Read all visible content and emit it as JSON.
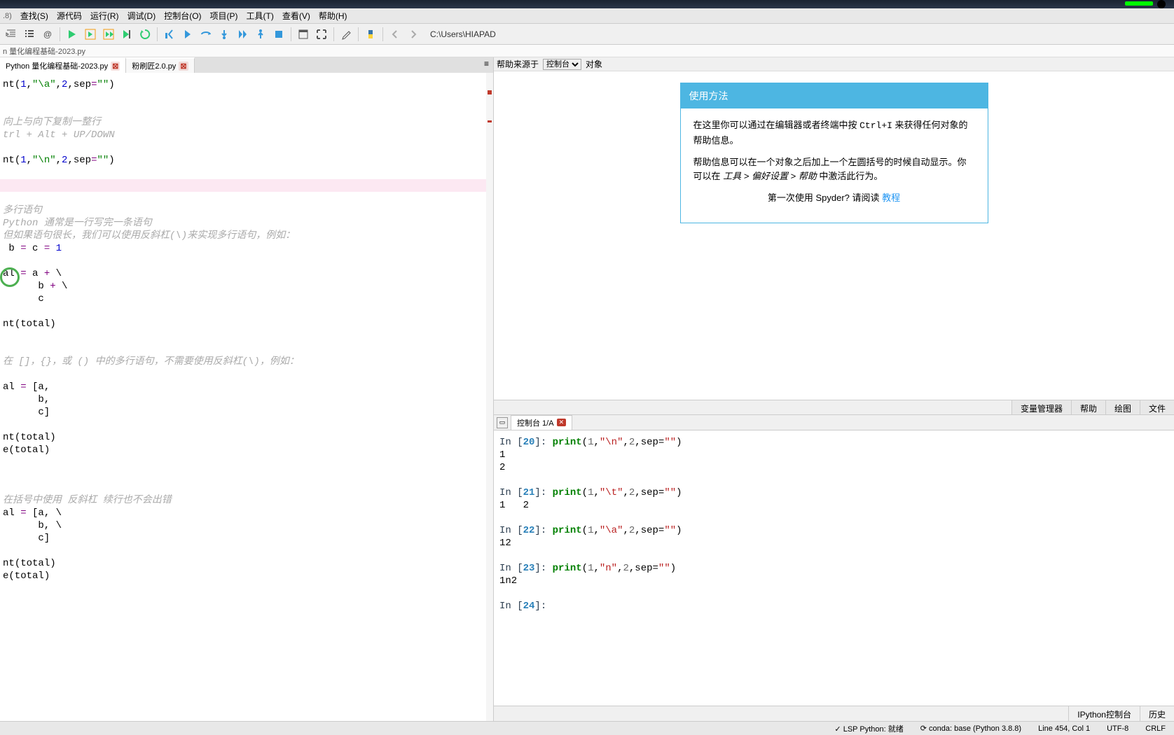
{
  "title_suffix": ".8)",
  "menubar": {
    "items": [
      "查找(S)",
      "源代码",
      "运行(R)",
      "调试(D)",
      "控制台(O)",
      "项目(P)",
      "工具(T)",
      "查看(V)",
      "帮助(H)"
    ]
  },
  "toolbar": {
    "path": "C:\\Users\\HIAPAD"
  },
  "breadcrumb": "n 量化编程基础-2023.py",
  "tabs": [
    {
      "label": "Python 量化编程基础-2023.py",
      "active": true
    },
    {
      "label": "粉刷匠2.0.py",
      "active": false
    }
  ],
  "help": {
    "source_label": "帮助来源于",
    "source_options": [
      "控制台"
    ],
    "object_label": "对象",
    "header": "使用方法",
    "para1a": "在这里你可以通过在编辑器或者终端中按 ",
    "para1_kb": "Ctrl+I",
    "para1b": " 来获得任何对象的帮助信息。",
    "para2a": "帮助信息可以在一个对象之后加上一个左圆括号的时候自动显示。你可以在 ",
    "para2b": "工具 > 偏好设置 > 帮助",
    "para2c": " 中激活此行为。",
    "footer_a": "第一次使用 Spyder? 请阅读 ",
    "footer_link": "教程",
    "tabs": [
      "变量管理器",
      "帮助",
      "绘图",
      "文件"
    ]
  },
  "console": {
    "tab_label": "控制台 1/A",
    "entries": [
      {
        "n": 20,
        "code_parts": [
          "print(",
          "1",
          ",",
          "\"\\n\"",
          ",",
          "2",
          ",sep=",
          "\"\"",
          ")"
        ],
        "output": "1\n2"
      },
      {
        "n": 21,
        "code_parts": [
          "print(",
          "1",
          ",",
          "\"\\t\"",
          ",",
          "2",
          ",sep=",
          "\"\"",
          ")"
        ],
        "output": "1   2"
      },
      {
        "n": 22,
        "code_parts": [
          "print(",
          "1",
          ",",
          "\"\\a\"",
          ",",
          "2",
          ",sep=",
          "\"\"",
          ")"
        ],
        "output": "12"
      },
      {
        "n": 23,
        "code_parts": [
          "print(",
          "1",
          ",",
          "\"n\"",
          ",",
          "2",
          ",sep=",
          "\"\"",
          ")"
        ],
        "output": "1n2"
      }
    ],
    "prompt_next": 24,
    "bottom_tabs": [
      "IPython控制台",
      "历史"
    ]
  },
  "status": {
    "lsp": "LSP Python: 就绪",
    "conda": "conda: base (Python 3.8.8)",
    "pos": "Line 454, Col 1",
    "enc": "UTF-8",
    "eol": "CRLF"
  }
}
